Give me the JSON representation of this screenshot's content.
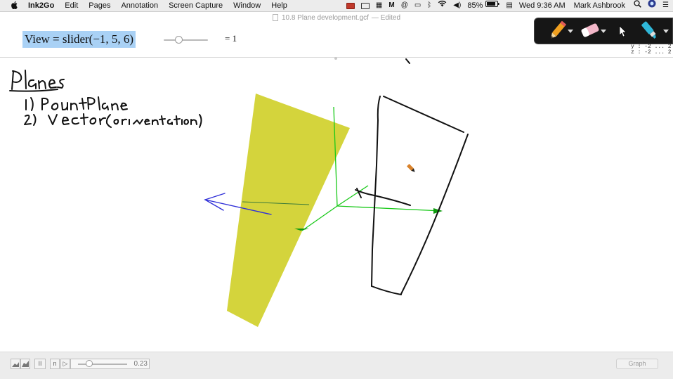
{
  "menubar": {
    "apple_glyph": "",
    "app_name": "Ink2Go",
    "menus": [
      "Edit",
      "Pages",
      "Annotation",
      "Screen Capture",
      "Window",
      "Help"
    ],
    "battery": "85%",
    "clock": "Wed 9:36 AM",
    "user": "Mark Ashbrook"
  },
  "window": {
    "title": "10.8 Plane development.gcf",
    "status": "— Edited"
  },
  "slider_bar": {
    "expression": "View = slider(−1, 5, 6)",
    "value_label": "= 1",
    "slider_fraction": 0.33
  },
  "corner_readout": "y : -2 ... 2\nz : -2 ... 2",
  "notes": {
    "heading": "Planes",
    "line1": "1) Point Plane",
    "line2": "2) Vector (orientation)"
  },
  "bottom_bar": {
    "animation_value": "0.23",
    "animation_fraction": 0.23,
    "graph_button": "Graph",
    "buttons": {
      "fast_label": "",
      "pause_label": "II",
      "n_label": "n",
      "play_label": "▷"
    }
  },
  "colors": {
    "plane_fill": "#d4d43c",
    "axis_green": "#19c919",
    "vector_blue": "#3030d8",
    "ink": "#111111",
    "highlight": "#a9d1f5"
  },
  "icons": {
    "pen": "pen-icon",
    "eraser": "eraser-icon",
    "pointer": "pointer-icon",
    "highlighter": "highlighter-icon"
  }
}
